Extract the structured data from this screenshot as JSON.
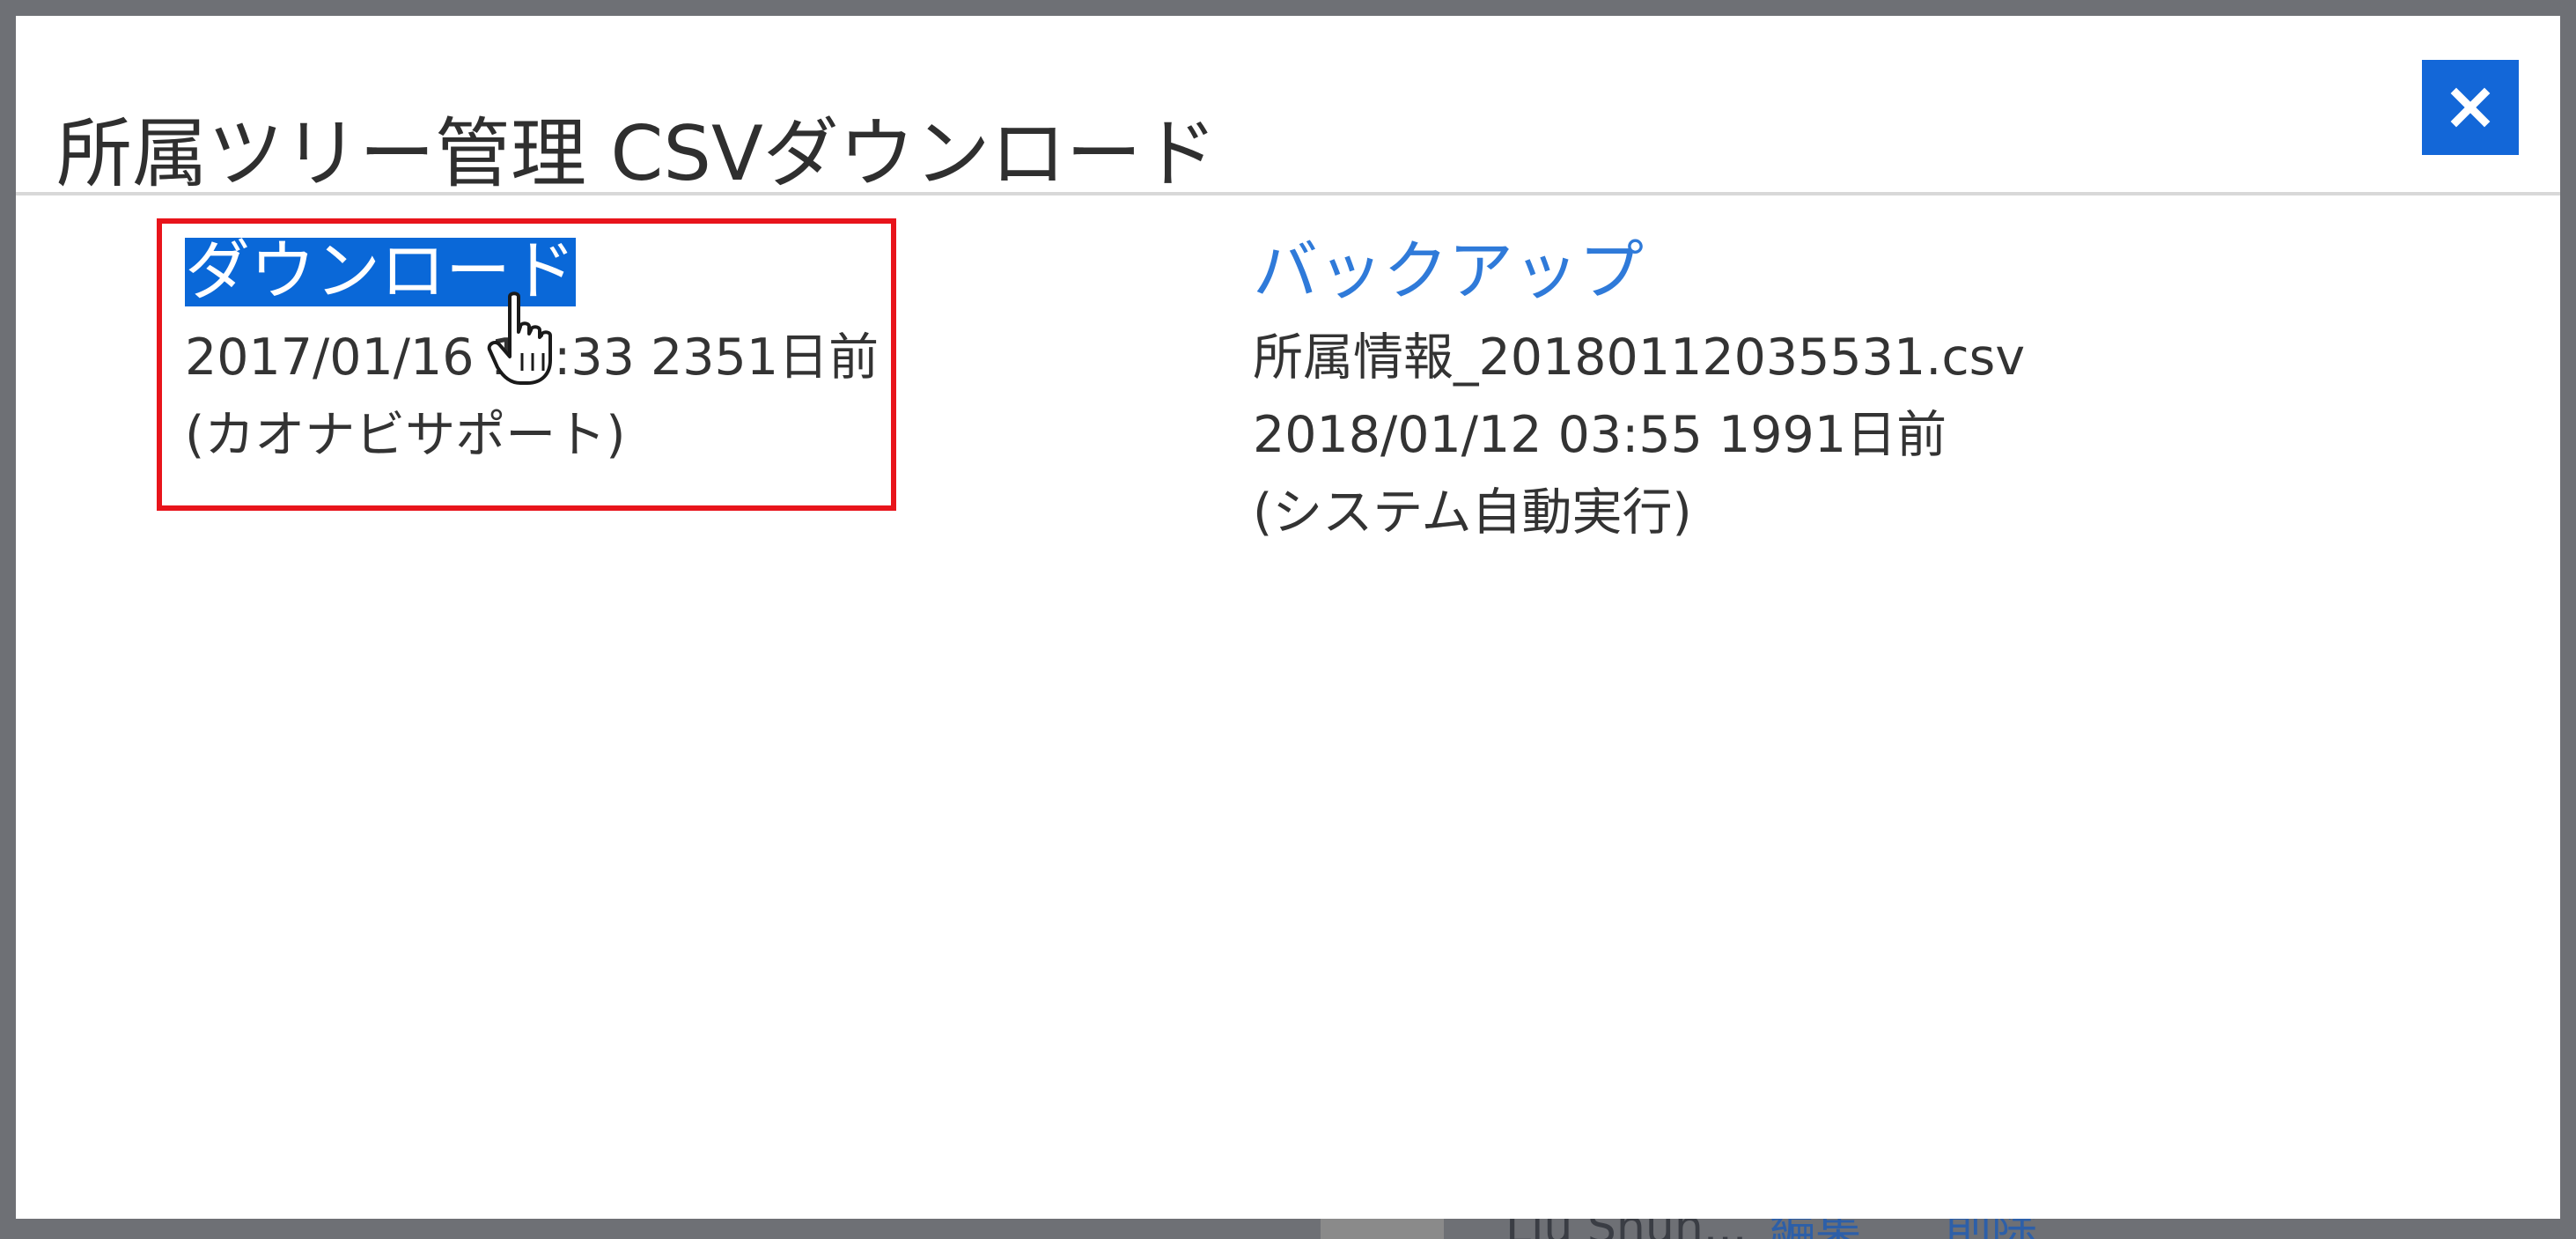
{
  "backdrop": {
    "row_name": "Liu Shun...",
    "edit_label": "編集",
    "delete_label": "削除"
  },
  "modal": {
    "title": "所属ツリー管理 CSVダウンロード",
    "close_icon": "close-icon",
    "download": {
      "label": "ダウンロード",
      "timestamp": "2017/01/16 16:33 2351日前",
      "author": "(カオナビサポート)"
    },
    "backup": {
      "label": "バックアップ",
      "filename": "所属情報_20180112035531.csv",
      "timestamp": "2018/01/12 03:55 1991日前",
      "author": "(システム自動実行)"
    }
  },
  "colors": {
    "accent": "#1367d8",
    "link": "#2f7ad9",
    "highlight_frame": "#e8141b",
    "overlay": "#6e7075"
  },
  "cursor_icon": "hand-pointer-icon"
}
